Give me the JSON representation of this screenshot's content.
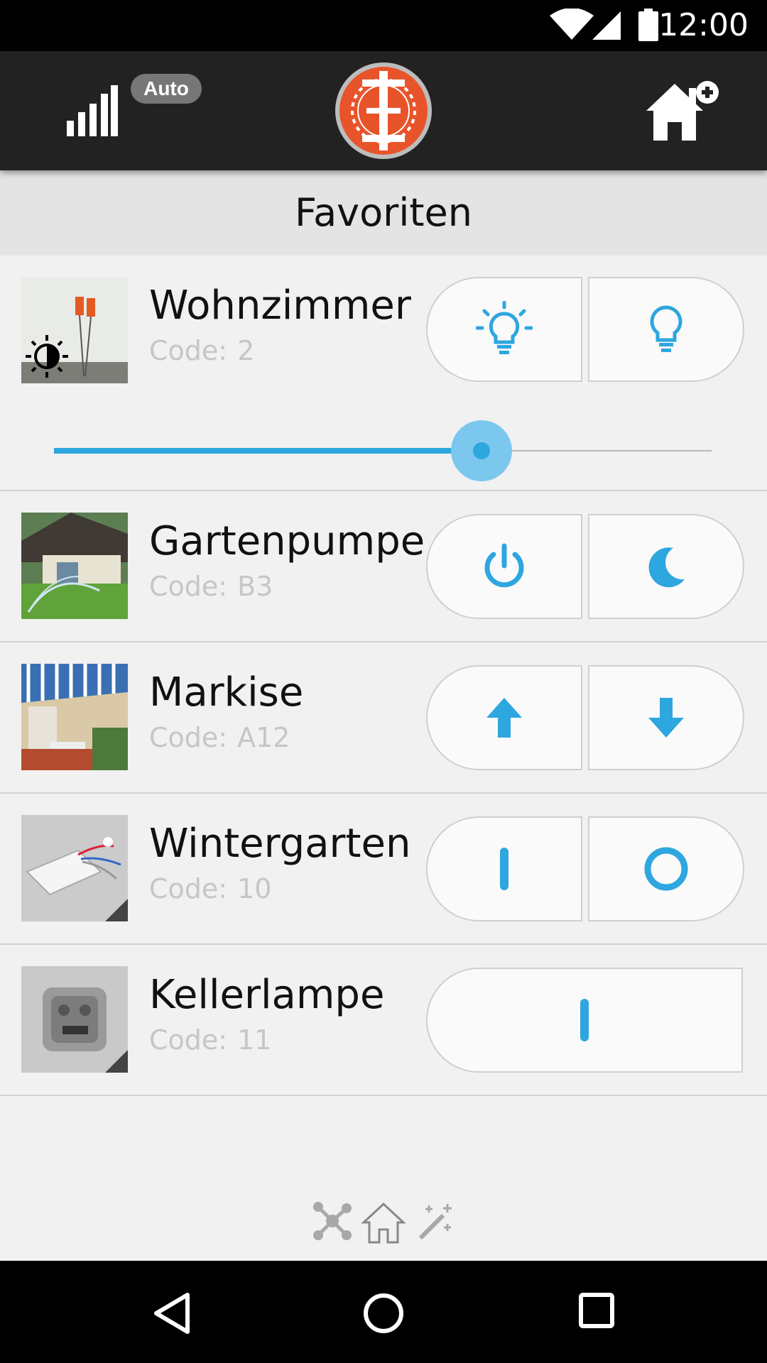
{
  "status_bar": {
    "time": "12:00"
  },
  "app_bar": {
    "auto_label": "Auto"
  },
  "screen": {
    "title": "Favoriten"
  },
  "devices": [
    {
      "name": "Wohnzimmer",
      "code_label": "Code:",
      "code": "2",
      "buttons": [
        "light-on-icon",
        "light-off-icon"
      ],
      "dimmer_level_percent": 65
    },
    {
      "name": "Gartenpumpe",
      "code_label": "Code:",
      "code": "B3",
      "buttons": [
        "power-icon",
        "moon-icon"
      ]
    },
    {
      "name": "Markise",
      "code_label": "Code:",
      "code": "A12",
      "buttons": [
        "arrow-up-icon",
        "arrow-down-icon"
      ]
    },
    {
      "name": "Wintergarten",
      "code_label": "Code:",
      "code": "10",
      "buttons": [
        "on-bar-icon",
        "off-circle-icon"
      ]
    },
    {
      "name": "Kellerlampe",
      "code_label": "Code:",
      "code": "11",
      "buttons": [
        "on-bar-icon"
      ]
    }
  ],
  "colors": {
    "accent": "#2ea6e0",
    "appbar": "#222222",
    "logo": "#e8542a"
  }
}
